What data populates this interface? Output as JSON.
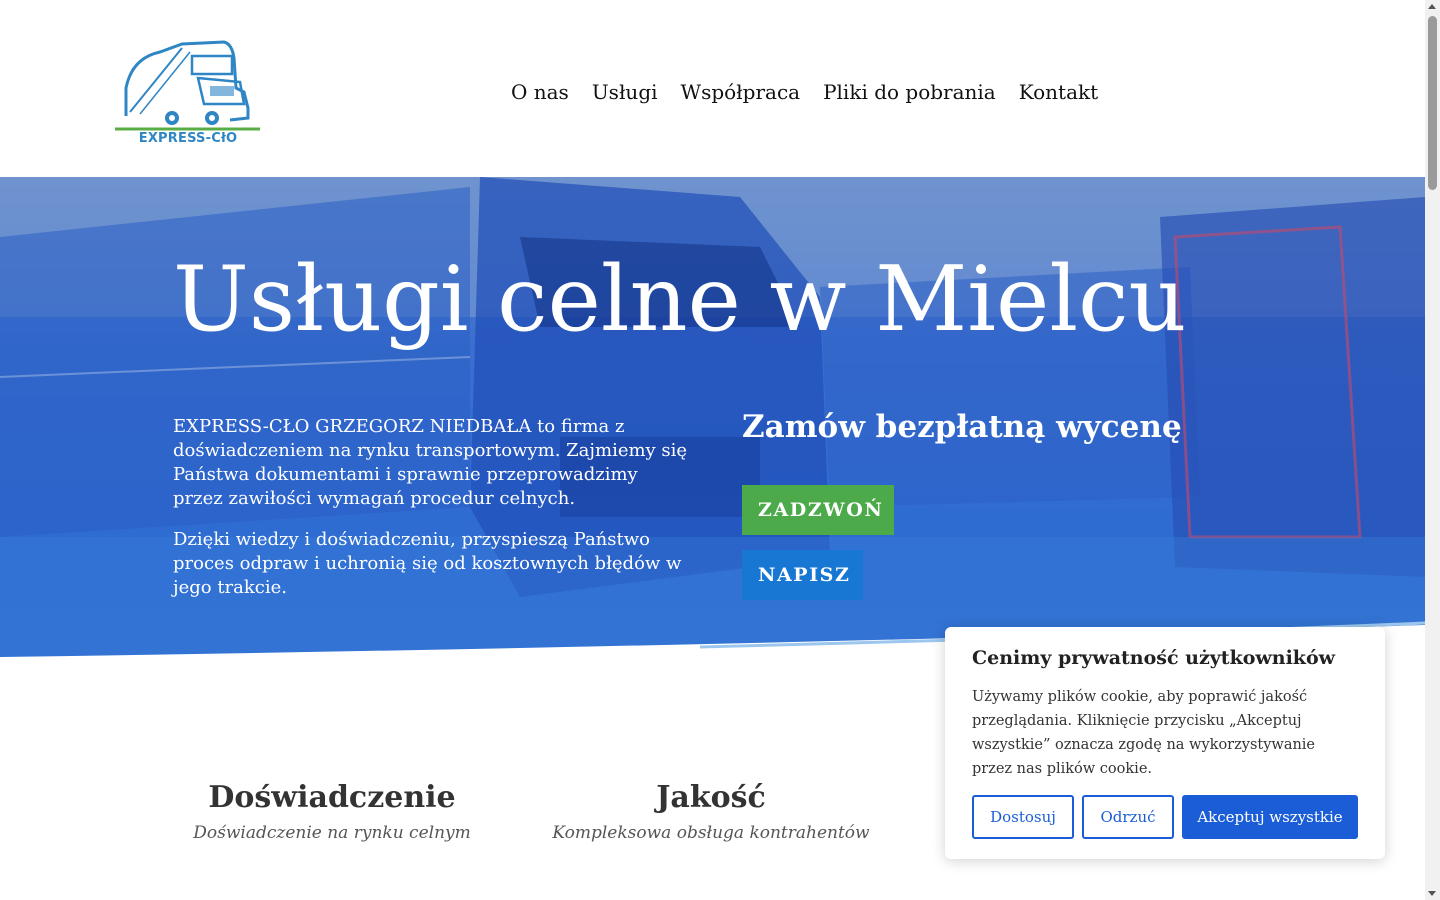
{
  "header": {
    "logo_text": "EXPRESS-CłO",
    "nav": [
      "O nas",
      "Usługi",
      "Współpraca",
      "Pliki do pobrania",
      "Kontakt"
    ]
  },
  "hero": {
    "title": "Usługi celne w Mielcu",
    "paragraph1": "EXPRESS-CŁO GRZEGORZ NIEDBAŁA to firma z doświadczeniem na rynku transportowym. Zajmiemy się Państwa dokumentami i sprawnie przeprowadzimy przez zawiłości wymagań procedur celnych.",
    "paragraph2": "Dzięki wiedzy i doświadczeniu, przyspieszą Państwo proces odpraw i uchronią się od kosztownych błędów w jego trakcie.",
    "quote_title": "Zamów bezpłatną wycenę",
    "call_button": "ZADZWOŃ",
    "write_button": "NAPISZ"
  },
  "features": [
    {
      "title": "Doświadczenie",
      "subtitle": "Doświadczenie na rynku celnym"
    },
    {
      "title": "Jakość",
      "subtitle": "Kompleksowa obsługa kontrahentów"
    }
  ],
  "cookie": {
    "title": "Cenimy prywatność użytkowników",
    "text": "Używamy plików cookie, aby poprawić jakość przeglądania. Kliknięcie przycisku „Akceptuj wszystkie” oznacza zgodę na wykorzystywanie przez nas plików cookie.",
    "customize": "Dostosuj",
    "reject": "Odrzuć",
    "accept": "Akceptuj wszystkie"
  },
  "colors": {
    "green": "#4caa4a",
    "blue": "#1877d3",
    "cookie_blue": "#1b5dd6",
    "logo_blue": "#2f86c4"
  }
}
